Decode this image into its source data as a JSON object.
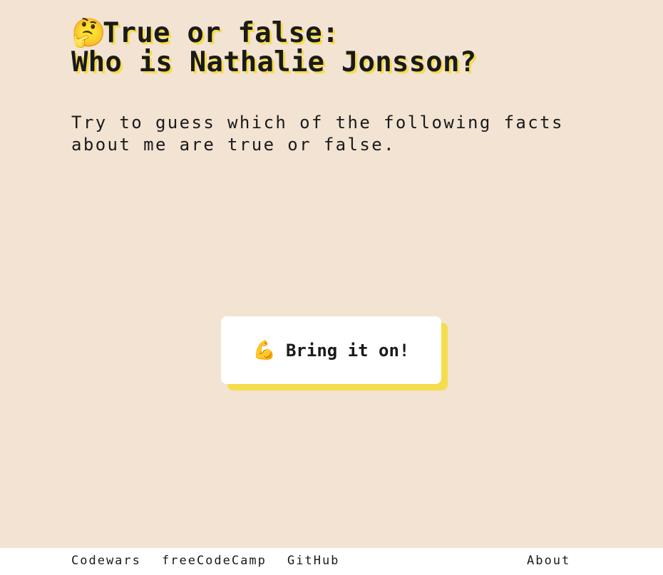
{
  "header": {
    "title_emoji": "🤔",
    "title_line1": "True or false:",
    "title_line2": "Who is Nathalie Jonsson?"
  },
  "intro": {
    "text": "Try to guess which of the following facts about me are true or false."
  },
  "cta": {
    "emoji": "💪",
    "label": "Bring it on!"
  },
  "footer": {
    "links": [
      "Codewars",
      "freeCodeCamp",
      "GitHub",
      "About"
    ]
  },
  "colors": {
    "background": "#f2e3d3",
    "accent_shadow": "#f5dd4b",
    "text": "#1a1a1a",
    "button_bg": "#ffffff"
  },
  "icons": {
    "title_icon": "thinking-face-icon",
    "button_icon": "flexed-biceps-icon"
  }
}
